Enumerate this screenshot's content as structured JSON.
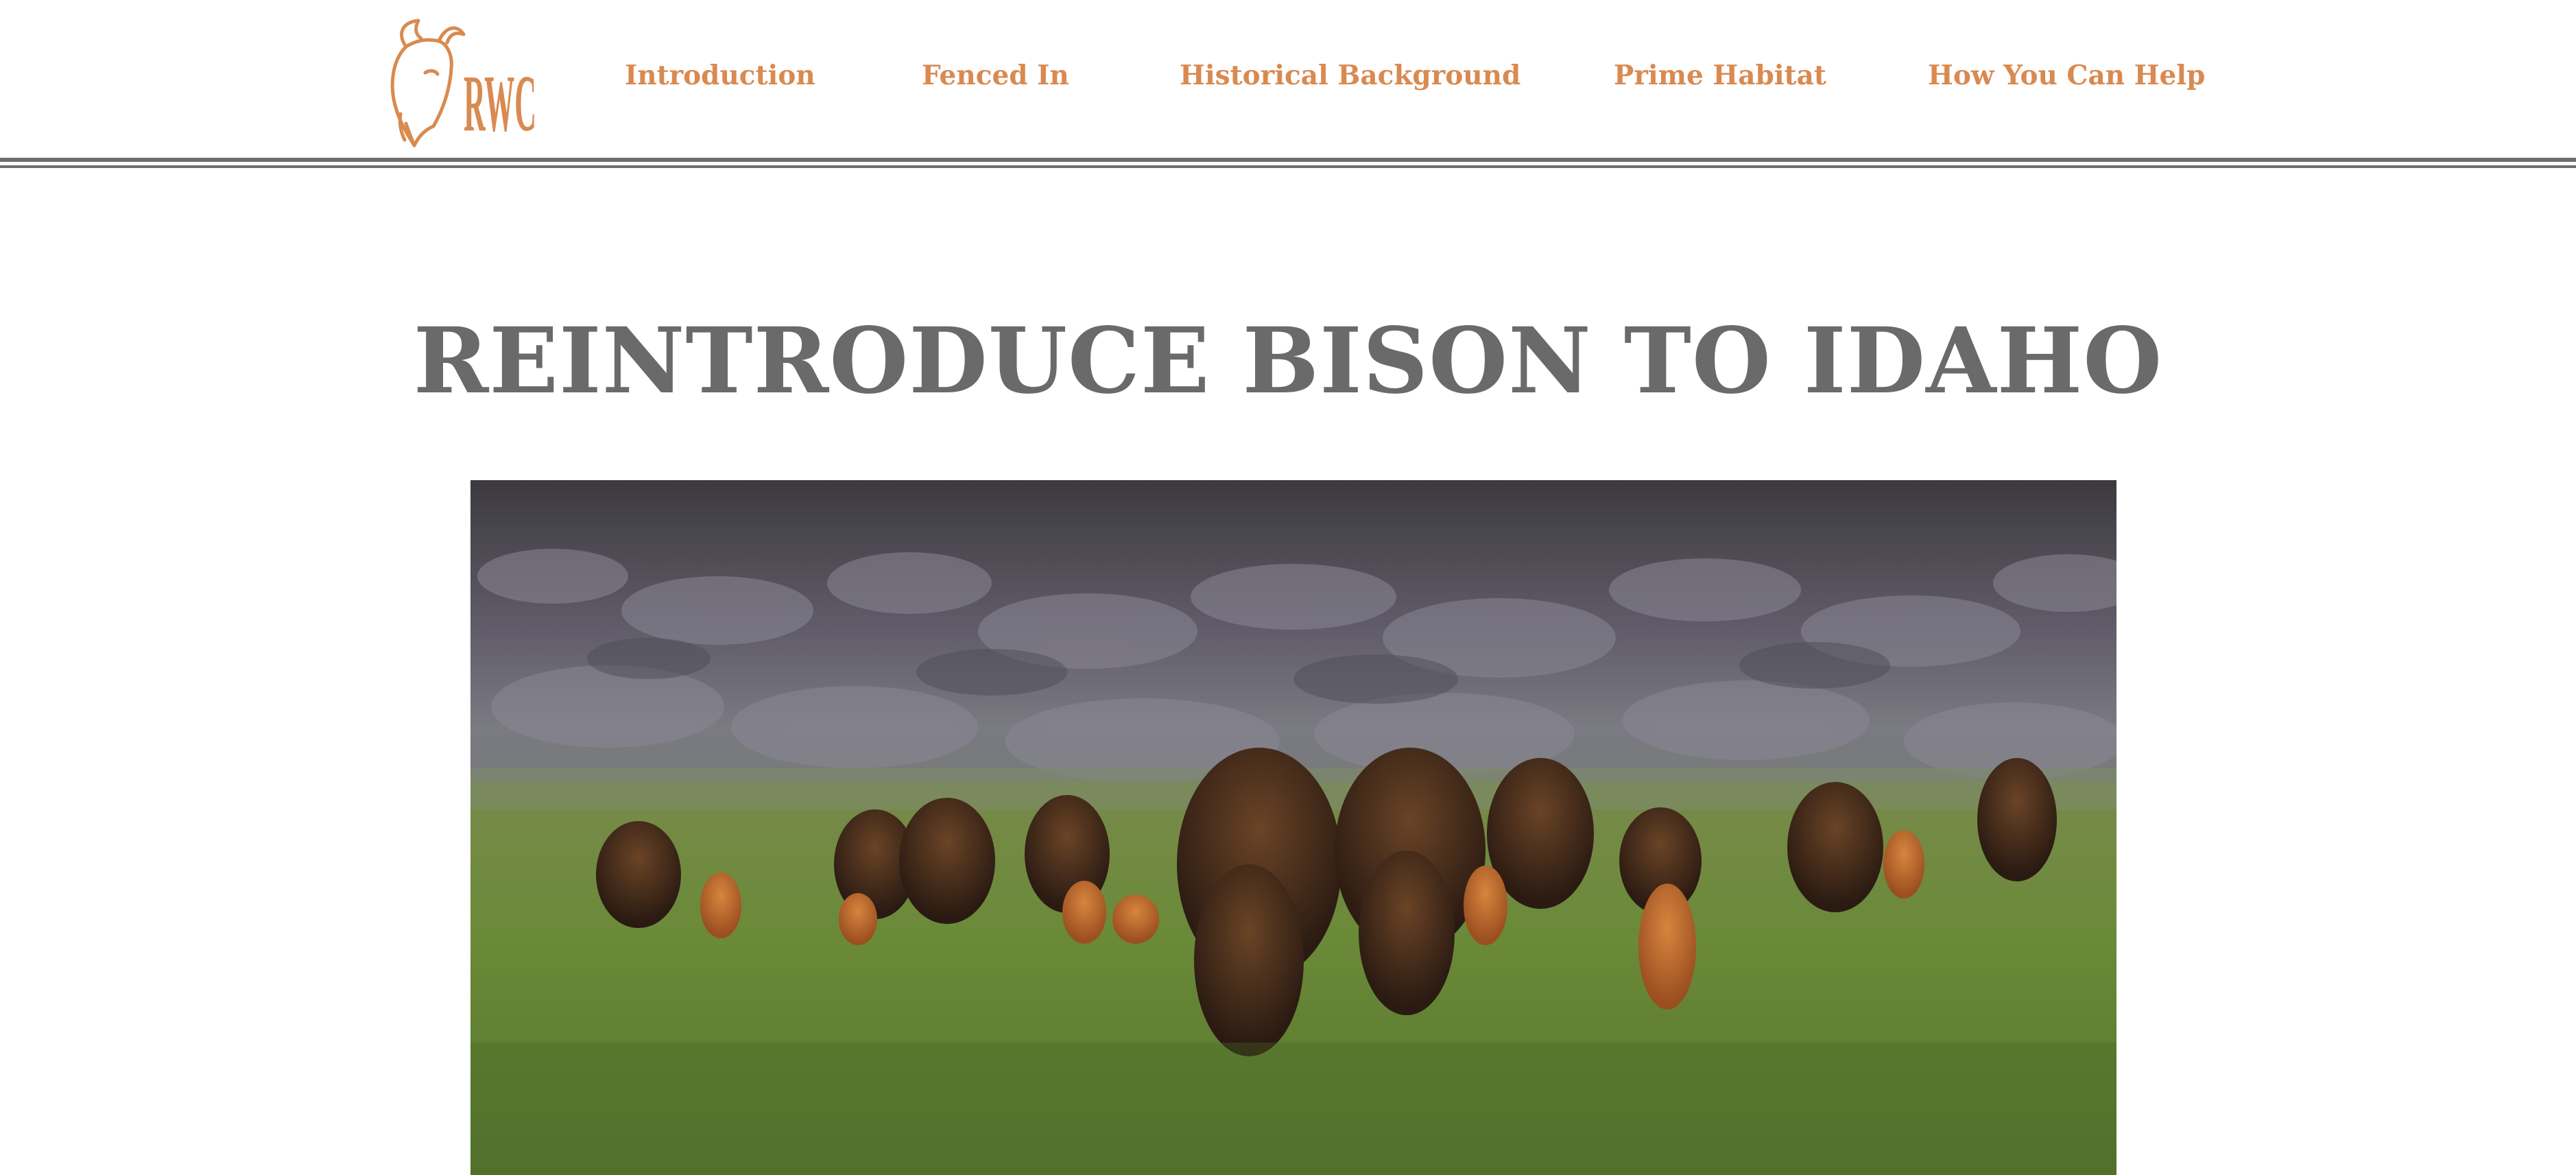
{
  "brand": {
    "logo_text": "RWC",
    "logo_icon": "bison-head-icon"
  },
  "nav": {
    "items": [
      {
        "label": "Introduction"
      },
      {
        "label": "Fenced In"
      },
      {
        "label": "Historical Background"
      },
      {
        "label": "Prime Habitat"
      },
      {
        "label": "How You Can Help"
      }
    ]
  },
  "main": {
    "title": "REINTRODUCE BISON TO IDAHO"
  },
  "colors": {
    "accent": "#d98a50",
    "title": "#6a6a6a",
    "divider": "#6e6e6e"
  }
}
